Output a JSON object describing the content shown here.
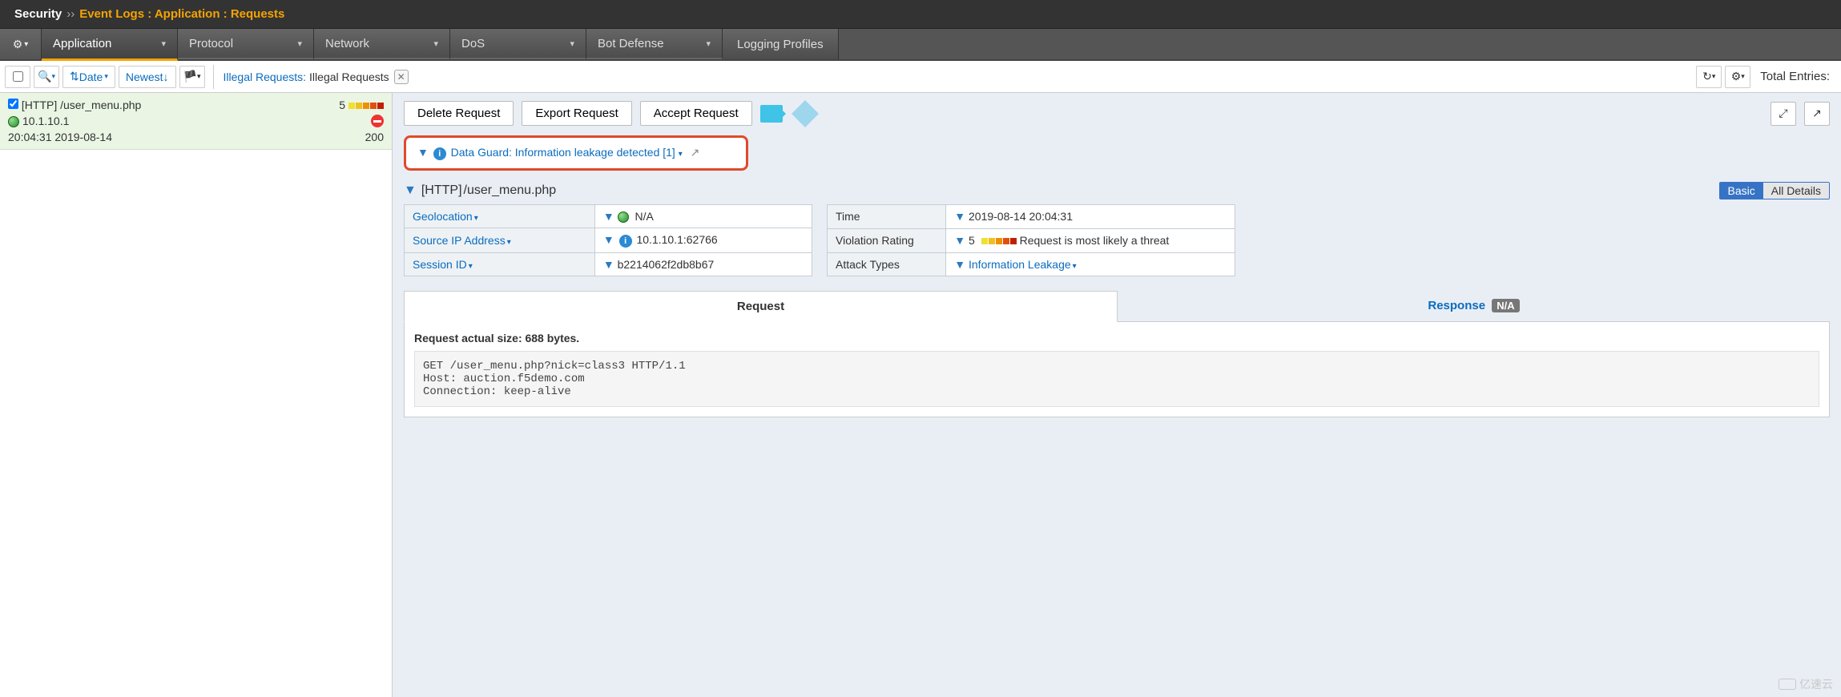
{
  "breadcrumb": {
    "section": "Security",
    "path": "Event Logs : Application : Requests"
  },
  "nav": {
    "tabs": [
      "Application",
      "Protocol",
      "Network",
      "DoS",
      "Bot Defense"
    ],
    "item": "Logging Profiles"
  },
  "toolbar": {
    "sort_field": "Date",
    "sort_dir": "Newest",
    "filter_label": "Illegal Requests:",
    "filter_value": "Illegal Requests",
    "total_label": "Total Entries:"
  },
  "log_entry": {
    "proto": "[HTTP]",
    "path": "/user_menu.php",
    "rating": "5",
    "ip": "10.1.10.1",
    "status": "200",
    "time": "20:04:31 2019-08-14"
  },
  "actions": {
    "delete": "Delete Request",
    "export": "Export Request",
    "accept": "Accept Request"
  },
  "violation": {
    "text": "Data Guard: Information leakage detected [1]"
  },
  "request_title": {
    "proto": "[HTTP]",
    "path": "/user_menu.php"
  },
  "view": {
    "basic": "Basic",
    "all": "All Details"
  },
  "left_props": {
    "geo_k": "Geolocation",
    "geo_v": "N/A",
    "src_k": "Source IP Address",
    "src_v": "10.1.10.1:62766",
    "sess_k": "Session ID",
    "sess_v": "b2214062f2db8b67"
  },
  "right_props": {
    "time_k": "Time",
    "time_v": "2019-08-14 20:04:31",
    "vr_k": "Violation Rating",
    "vr_v": "5",
    "vr_desc": "Request is most likely a threat",
    "at_k": "Attack Types",
    "at_v": "Information Leakage"
  },
  "rr": {
    "req": "Request",
    "resp": "Response",
    "na": "N/A"
  },
  "body": {
    "size_label": "Request actual size: 688 bytes.",
    "raw": "GET /user_menu.php?nick=class3 HTTP/1.1\nHost: auction.f5demo.com\nConnection: keep-alive"
  },
  "watermark": "亿速云"
}
